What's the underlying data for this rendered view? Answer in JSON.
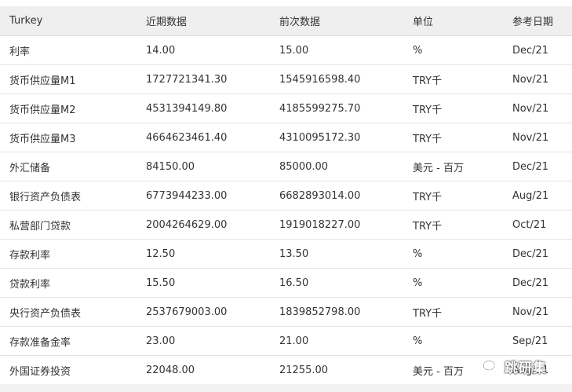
{
  "table": {
    "headers": [
      "Turkey",
      "近期数据",
      "前次数据",
      "单位",
      "参考日期"
    ],
    "rows": [
      [
        "利率",
        "14.00",
        "15.00",
        "%",
        "Dec/21"
      ],
      [
        "货币供应量M1",
        "1727721341.30",
        "1545916598.40",
        "TRY千",
        "Nov/21"
      ],
      [
        "货币供应量M2",
        "4531394149.80",
        "4185599275.70",
        "TRY千",
        "Nov/21"
      ],
      [
        "货币供应量M3",
        "4664623461.40",
        "4310095172.30",
        "TRY千",
        "Nov/21"
      ],
      [
        "外汇储备",
        "84150.00",
        "85000.00",
        "美元 - 百万",
        "Dec/21"
      ],
      [
        "银行资产负债表",
        "6773944233.00",
        "6682893014.00",
        "TRY千",
        "Aug/21"
      ],
      [
        "私营部门贷款",
        "2004264629.00",
        "1919018227.00",
        "TRY千",
        "Oct/21"
      ],
      [
        "存款利率",
        "12.50",
        "13.50",
        "%",
        "Dec/21"
      ],
      [
        "贷款利率",
        "15.50",
        "16.50",
        "%",
        "Dec/21"
      ],
      [
        "央行资产负债表",
        "2537679003.00",
        "1839852798.00",
        "TRY千",
        "Nov/21"
      ],
      [
        "存款准备金率",
        "23.00",
        "21.00",
        "%",
        "Sep/21"
      ],
      [
        "外国证券投资",
        "22048.00",
        "21255.00",
        "美元 - 百万",
        "Aug/21"
      ]
    ]
  },
  "watermark": {
    "text": "跳研集",
    "icon": "wechat-icon"
  }
}
